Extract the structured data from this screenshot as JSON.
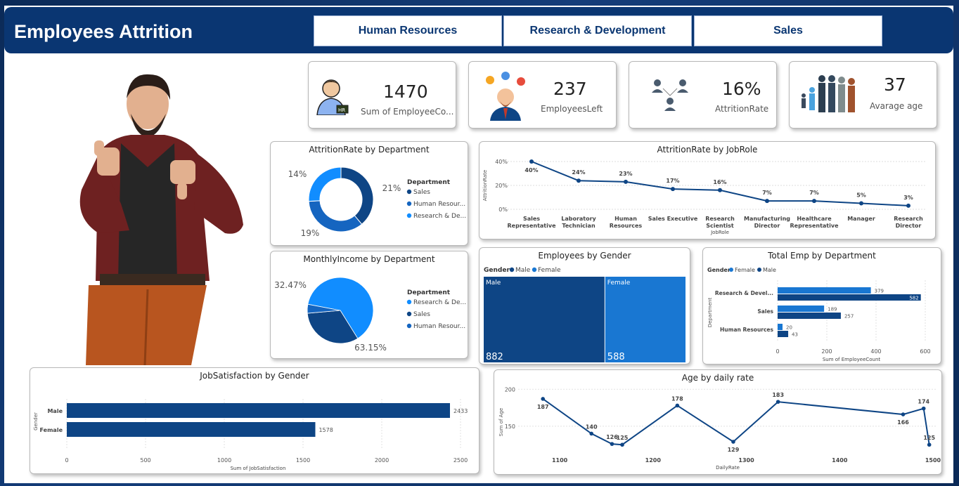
{
  "header": {
    "title": "Employees Attrition",
    "tabs": [
      "Human Resources",
      "Research & Development",
      "Sales"
    ]
  },
  "kpis": [
    {
      "value": "1470",
      "label": "Sum of EmployeeCo...",
      "icon": "hr-person-icon"
    },
    {
      "value": "237",
      "label": "EmployeesLeft",
      "icon": "businessman-icon"
    },
    {
      "value": "16%",
      "label": "AttritionRate",
      "icon": "network-people-icon"
    },
    {
      "value": "37",
      "label": "Avarage age",
      "icon": "family-group-icon"
    }
  ],
  "colors": {
    "dark": "#0e4585",
    "mid": "#1565c0",
    "light": "#118dff",
    "navy": "#0a3672"
  },
  "chart_data": [
    {
      "type": "pie",
      "donut": true,
      "title": "AttritionRate by Department",
      "legend_title": "Department",
      "categories": [
        "Sales",
        "Human Resour...",
        "Research & De..."
      ],
      "values": [
        21,
        19,
        14
      ],
      "value_labels": [
        "21%",
        "19%",
        "14%"
      ]
    },
    {
      "type": "pie",
      "title": "MonthlyIncome by Department",
      "legend_title": "Department",
      "categories": [
        "Research & De...",
        "Sales",
        "Human Resour..."
      ],
      "values": [
        63.15,
        32.47,
        4.38
      ],
      "value_labels": [
        "63.15%",
        "32.47%"
      ]
    },
    {
      "type": "line",
      "title": "AttritionRate by JobRole",
      "xlabel": "JobRole",
      "ylabel": "AttritionRate",
      "categories": [
        [
          "Sales",
          "Representative"
        ],
        [
          "Laboratory",
          "Technician"
        ],
        [
          "Human",
          "Resources"
        ],
        [
          "Sales Executive"
        ],
        [
          "Research",
          "Scientist"
        ],
        [
          "Manufacturing",
          "Director"
        ],
        [
          "Healthcare",
          "Representative"
        ],
        [
          "Manager"
        ],
        [
          "Research",
          "Director"
        ]
      ],
      "values": [
        40,
        24,
        23,
        17,
        16,
        7,
        7,
        5,
        3
      ],
      "value_labels": [
        "40%",
        "24%",
        "23%",
        "17%",
        "16%",
        "7%",
        "7%",
        "5%",
        "3%"
      ],
      "yticks": [
        "0%",
        "20%",
        "40%"
      ],
      "ylim": [
        0,
        40
      ]
    },
    {
      "type": "treemap",
      "title": "Employees by Gender",
      "legend_title": "Gender",
      "legend": [
        "Male",
        "Female"
      ],
      "categories": [
        "Male",
        "Female"
      ],
      "values": [
        882,
        588
      ],
      "value_labels": [
        "882",
        "588"
      ]
    },
    {
      "type": "bar",
      "orientation": "horizontal",
      "title": "Total Emp by Department",
      "legend_title": "Gender",
      "legend": [
        "Female",
        "Male"
      ],
      "ylabel": "Department",
      "xlabel": "Sum of EmployeeCount",
      "categories": [
        "Research & Devel...",
        "Sales",
        "Human Resources"
      ],
      "series": [
        {
          "name": "Female",
          "values": [
            379,
            189,
            20
          ]
        },
        {
          "name": "Male",
          "values": [
            582,
            257,
            43
          ]
        }
      ],
      "xticks": [
        "0",
        "200",
        "400",
        "600"
      ],
      "xlim": [
        0,
        600
      ]
    },
    {
      "type": "bar",
      "orientation": "horizontal",
      "title": "JobSatisfaction by Gender",
      "ylabel": "Gender",
      "xlabel": "Sum of JobSatisfaction",
      "categories": [
        "Male",
        "Female"
      ],
      "values": [
        2433,
        1578
      ],
      "value_labels": [
        "2433",
        "1578"
      ],
      "xticks": [
        "0",
        "500",
        "1000",
        "1500",
        "2000",
        "2500"
      ],
      "xlim": [
        0,
        2500
      ]
    },
    {
      "type": "line",
      "title": "Age by daily rate",
      "xlabel": "DailyRate",
      "ylabel": "Sum of Age",
      "x": [
        1082,
        1134,
        1156,
        1167,
        1226,
        1286,
        1334,
        1468,
        1490,
        1496
      ],
      "values": [
        187,
        140,
        126,
        125,
        178,
        129,
        183,
        166,
        174,
        125
      ],
      "value_labels": [
        "187",
        "140",
        "126",
        "125",
        "178",
        "129",
        "183",
        "166",
        "174",
        "125"
      ],
      "xticks": [
        "1100",
        "1200",
        "1300",
        "1400",
        "1500"
      ],
      "yticks": [
        "150",
        "200"
      ],
      "xlim": [
        1060,
        1500
      ],
      "ylim": [
        110,
        205
      ]
    }
  ]
}
